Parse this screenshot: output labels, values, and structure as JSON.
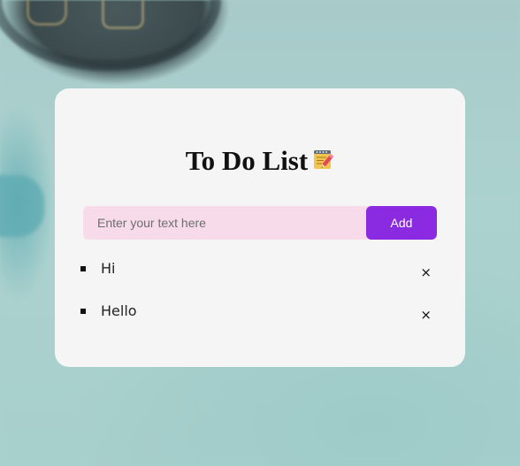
{
  "header": {
    "title": "To Do List",
    "title_icon": "memo-icon"
  },
  "input": {
    "placeholder": "Enter your text here",
    "value": ""
  },
  "add_button": {
    "label": "Add",
    "color": "#8a2be2"
  },
  "input_background": "#f8dbea",
  "tasks": [
    {
      "text": "Hi",
      "remove_label": "×"
    },
    {
      "text": "Hello",
      "remove_label": "×"
    }
  ]
}
